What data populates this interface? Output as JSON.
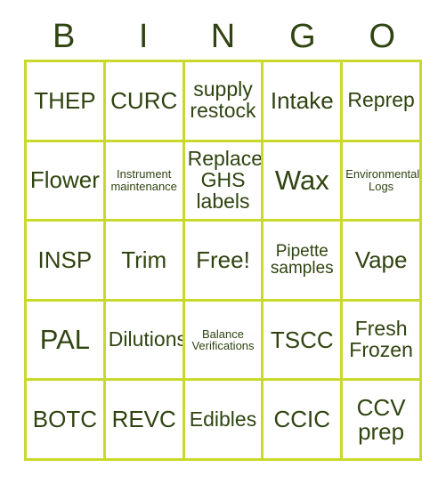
{
  "card": {
    "header_letters": [
      "B",
      "I",
      "N",
      "G",
      "O"
    ],
    "colors": {
      "grid_border": "#c9d92c",
      "text": "#2f4410",
      "background": "#ffffff"
    },
    "rows": [
      [
        {
          "text": "THEP",
          "size": "sz-lg"
        },
        {
          "text": "CURC",
          "size": "sz-lg"
        },
        {
          "text": "supply restock",
          "size": "sz-md"
        },
        {
          "text": "Intake",
          "size": "sz-lg"
        },
        {
          "text": "Reprep",
          "size": "sz-md"
        }
      ],
      [
        {
          "text": "Flower",
          "size": "sz-lg"
        },
        {
          "text": "Instrument maintenance",
          "size": "sz-xs"
        },
        {
          "text": "Replace GHS labels",
          "size": "sz-md"
        },
        {
          "text": "Wax",
          "size": "sz-xl"
        },
        {
          "text": "Environmental Logs",
          "size": "sz-xs"
        }
      ],
      [
        {
          "text": "INSP",
          "size": "sz-lg"
        },
        {
          "text": "Trim",
          "size": "sz-lg"
        },
        {
          "text": "Free!",
          "size": "sz-lg"
        },
        {
          "text": "Pipette samples",
          "size": "sz-sm"
        },
        {
          "text": "Vape",
          "size": "sz-lg"
        }
      ],
      [
        {
          "text": "PAL",
          "size": "sz-xl"
        },
        {
          "text": "Dilutions",
          "size": "sz-md"
        },
        {
          "text": "Balance Verifications",
          "size": "sz-xs"
        },
        {
          "text": "TSCC",
          "size": "sz-lg"
        },
        {
          "text": "Fresh Frozen",
          "size": "sz-md"
        }
      ],
      [
        {
          "text": "BOTC",
          "size": "sz-lg"
        },
        {
          "text": "REVC",
          "size": "sz-lg"
        },
        {
          "text": "Edibles",
          "size": "sz-md"
        },
        {
          "text": "CCIC",
          "size": "sz-lg"
        },
        {
          "text": "CCV prep",
          "size": "sz-lg"
        }
      ]
    ]
  }
}
